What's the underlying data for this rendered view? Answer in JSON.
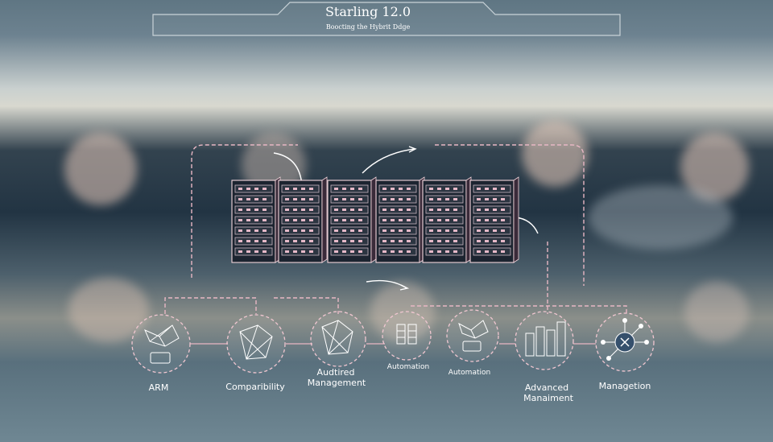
{
  "header": {
    "title": "Starling 12.0",
    "subtitle": "Boocting the Hybrit Ddge"
  },
  "nodes": [
    {
      "label": "ARM",
      "icon": "network-device-icon"
    },
    {
      "label": "Comparibility",
      "icon": "network-mesh-icon"
    },
    {
      "label_line1": "Audtired",
      "label_line2": "Management",
      "icon": "network-mesh-icon"
    },
    {
      "label": "Automation",
      "icon": "server-stack-icon"
    },
    {
      "label": "Automation",
      "icon": "network-device-icon"
    },
    {
      "label_line1": "Advanced",
      "label_line2": "Manaiment",
      "icon": "building-bars-icon"
    },
    {
      "label": "Managetion",
      "icon": "hub-icon"
    }
  ],
  "colors": {
    "accent_line": "#e8b7c4",
    "text": "#ffffff",
    "rack": "#1c2430"
  }
}
